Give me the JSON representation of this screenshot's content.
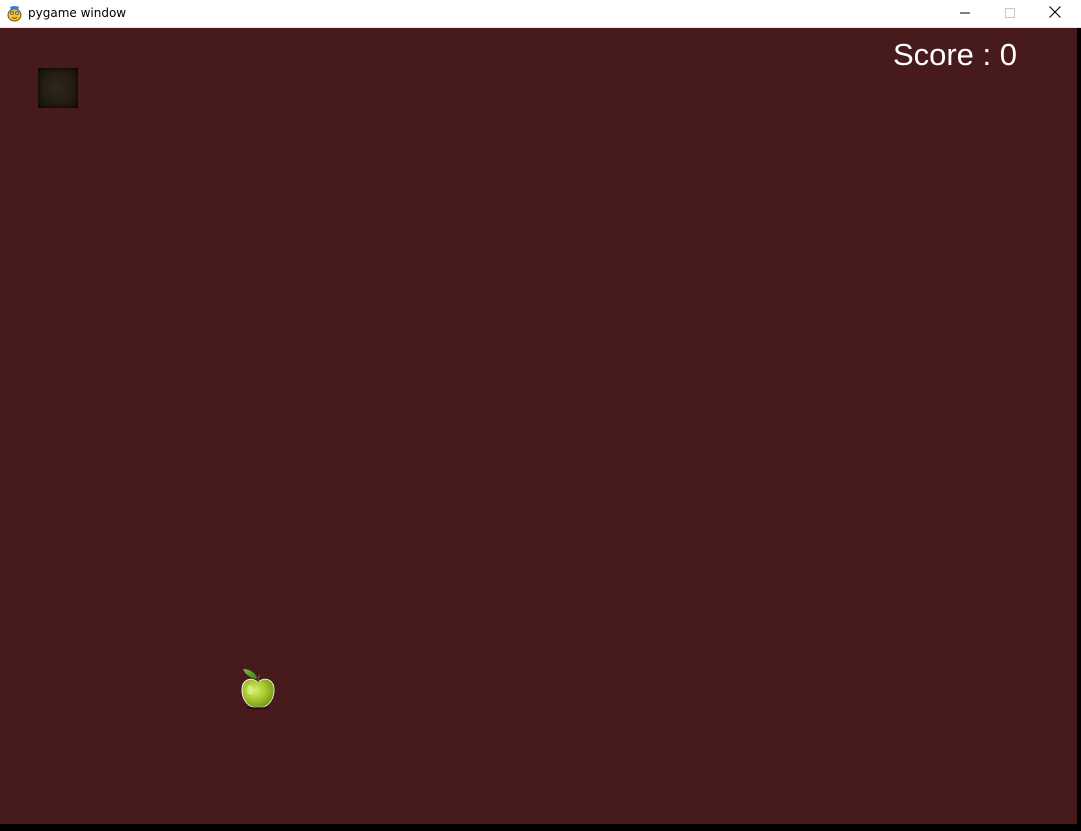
{
  "window": {
    "title": "pygame window",
    "app_icon": "pygame-snake-icon",
    "controls": {
      "minimize_icon": "minimize-icon",
      "maximize_icon": "maximize-icon",
      "close_icon": "close-icon"
    }
  },
  "game": {
    "background_color": "#471a1b",
    "score_text": "Score : 0",
    "score_value": 0,
    "snake": {
      "segments": 1,
      "head_icon": "snake-head-block"
    },
    "food": {
      "icon": "green-apple-icon"
    }
  }
}
